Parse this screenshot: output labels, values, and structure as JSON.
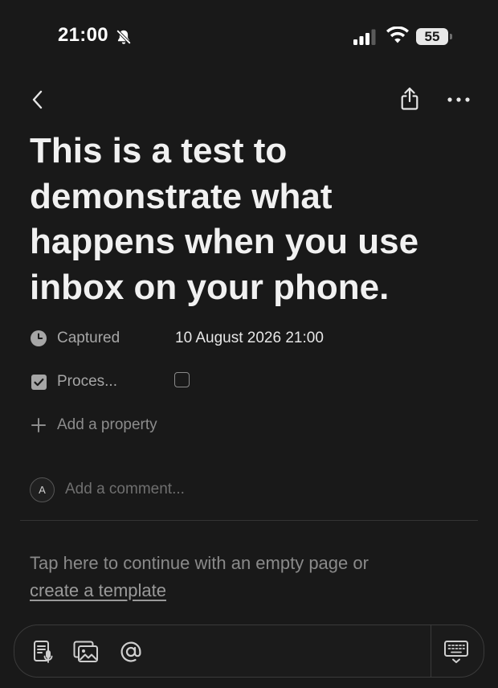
{
  "status_bar": {
    "time": "21:00",
    "battery": "55",
    "icons": [
      "bell-slash-icon",
      "cellular-signal-icon",
      "wifi-icon",
      "battery-icon"
    ]
  },
  "nav": {
    "icons": [
      "chevron-left-icon",
      "share-icon",
      "ellipsis-icon"
    ]
  },
  "page": {
    "title": "This is a test to demonstrate what happens when you use inbox on your phone."
  },
  "properties": [
    {
      "icon": "clock-icon",
      "label": "Captured",
      "value": "10 August 2026 21:00"
    },
    {
      "icon": "checkbox-icon",
      "label": "Proces...",
      "checked": false
    }
  ],
  "add_property": {
    "icon": "plus-icon",
    "label": "Add a property"
  },
  "comment": {
    "avatar": "A",
    "placeholder": "Add a comment..."
  },
  "empty_hint": {
    "text": "Tap here to continue with an empty page or",
    "link": "create a template"
  },
  "toolbar": {
    "icons": [
      "dictation-icon",
      "image-icon",
      "at-mention-icon",
      "keyboard-icon"
    ]
  },
  "colors": {
    "background": "#191919",
    "text": "#f1f1f1",
    "muted": "#8a8a8a"
  }
}
